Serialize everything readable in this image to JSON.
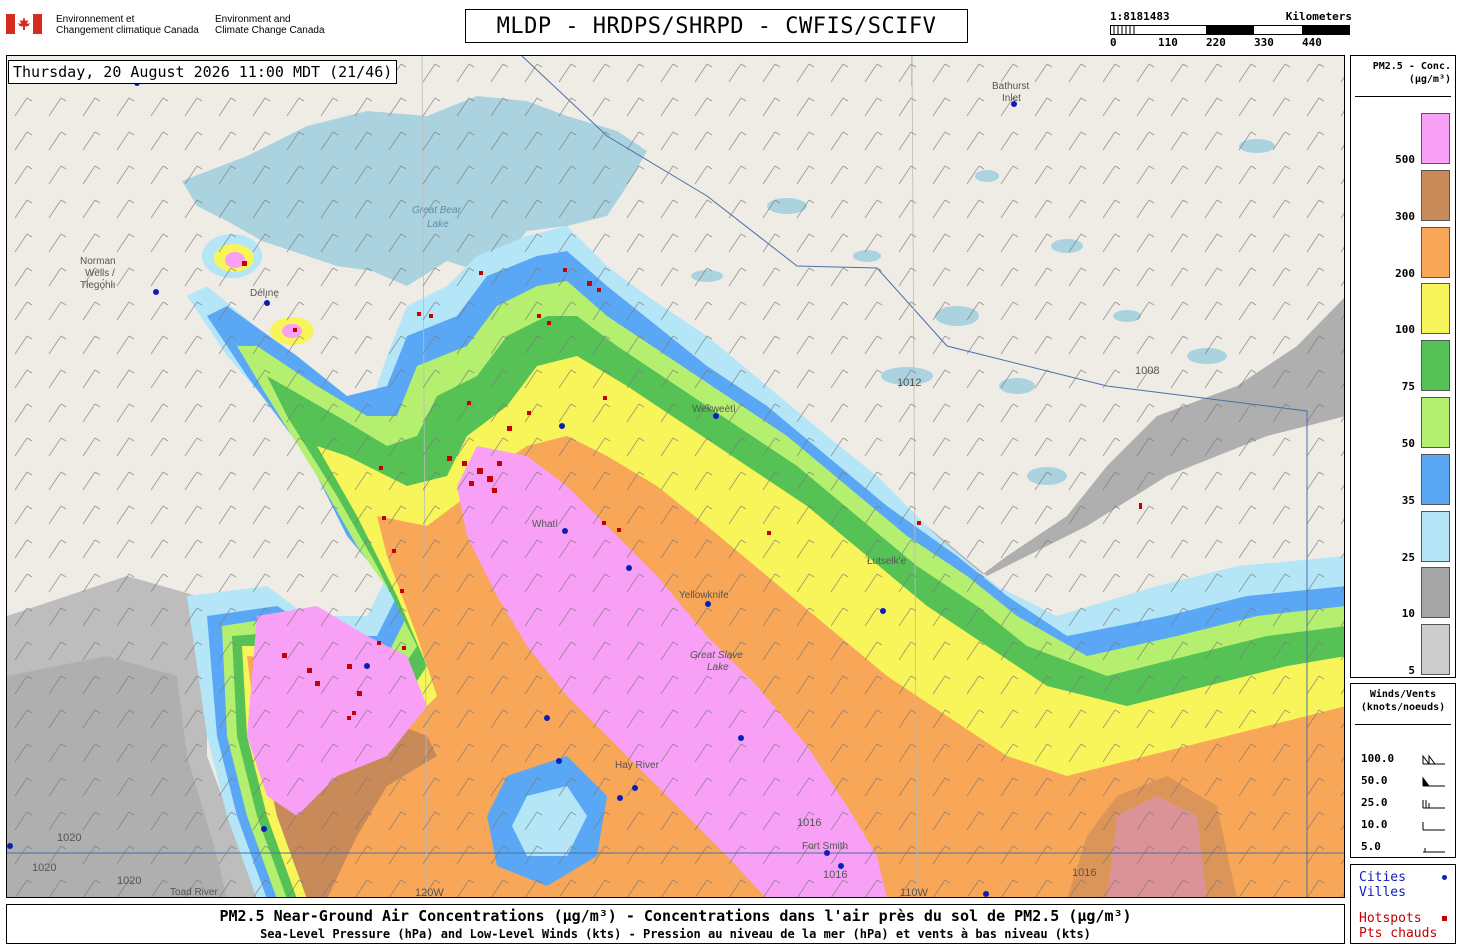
{
  "agency": {
    "fr": [
      "Environnement et",
      "Changement climatique Canada"
    ],
    "en": [
      "Environment and",
      "Climate Change Canada"
    ]
  },
  "header": {
    "title": "MLDP - HRDPS/SHRPD - CWFIS/SCIFV"
  },
  "scale_bar": {
    "ratio": "1:8181483",
    "unit": "Kilometers",
    "ticks": [
      "0",
      "110",
      "220",
      "330",
      "440"
    ]
  },
  "timestamp": "Thursday, 20 August 2026 11:00 MDT (21/46)",
  "legend": {
    "title": [
      "PM2.5 - Conc.",
      "(µg/m³)"
    ],
    "levels": [
      {
        "label": "500",
        "color": "#f7a0f5"
      },
      {
        "label": "300",
        "color": "#c98a5a"
      },
      {
        "label": "200",
        "color": "#f8a657"
      },
      {
        "label": "100",
        "color": "#f8f55a"
      },
      {
        "label": "75",
        "color": "#56c256"
      },
      {
        "label": "50",
        "color": "#b5ef6f"
      },
      {
        "label": "35",
        "color": "#5aa8f5"
      },
      {
        "label": "25",
        "color": "#b4e6f8"
      },
      {
        "label": "10",
        "color": "#a5a5a5"
      },
      {
        "label": "5",
        "color": "#cccccc"
      }
    ]
  },
  "wind_legend": {
    "title": [
      "Winds/Vents",
      "(knots/noeuds)"
    ],
    "items": [
      "100.0",
      "50.0",
      "25.0",
      "10.0",
      "5.0"
    ]
  },
  "point_legend": {
    "cities": [
      "Cities",
      "Villes"
    ],
    "hotspots": [
      "Hotspots",
      "Pts chauds"
    ],
    "city_color": "#0b1fb8",
    "hotspot_color": "#c40000"
  },
  "map_labels": {
    "lake_bear": [
      "Great Bear",
      "Lake"
    ],
    "norman_wells": [
      "Norman",
      "Wells /",
      "Tłegǫ́hłı"
    ],
    "bathurst": [
      "Bathurst",
      "Inlet"
    ],
    "wekweeti": "Wekweètì",
    "whati": "Whatì",
    "yellowknife": "Yellowknife",
    "lutselke": "Łutselk'e",
    "great_slave": [
      "Great Slave",
      "Lake"
    ],
    "hay_river": "Hay River",
    "fort_smith": "Fort Smith",
    "toad_river": "Toad River",
    "deline": "Délı̨nę",
    "pressure_labels": [
      "1008",
      "1012",
      "1016",
      "1020",
      "1020",
      "1020",
      "1016",
      "1016"
    ],
    "meridian_labels": [
      "120W",
      "110W"
    ]
  },
  "caption": {
    "line1": "PM2.5 Near-Ground Air Concentrations (µg/m³) - Concentrations dans l'air près du sol de PM2.5 (µg/m³)",
    "line2": "Sea-Level Pressure (hPa) and Low-Level Winds (kts) - Pression au niveau de la mer (hPa) et vents à bas niveau (kts)"
  }
}
